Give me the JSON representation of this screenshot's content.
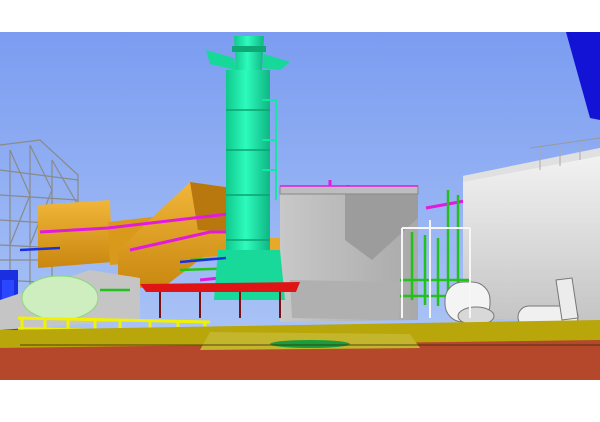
{
  "image": {
    "kind": "3D plant model render",
    "colors": {
      "page_bg": "#ffffff",
      "sky_top": "#7f9ff2",
      "sky_bottom": "#a6c1f4",
      "stack": "#19e6a8",
      "duct": "#e6a51f",
      "concrete": "#bdbdbd",
      "ground": "#b5472b",
      "pad": "#b8a60a",
      "magenta": "#e21adf",
      "green_pipe": "#22c21a",
      "blue_pipe": "#1a2fe0",
      "yellow_rail": "#e8e800"
    }
  }
}
